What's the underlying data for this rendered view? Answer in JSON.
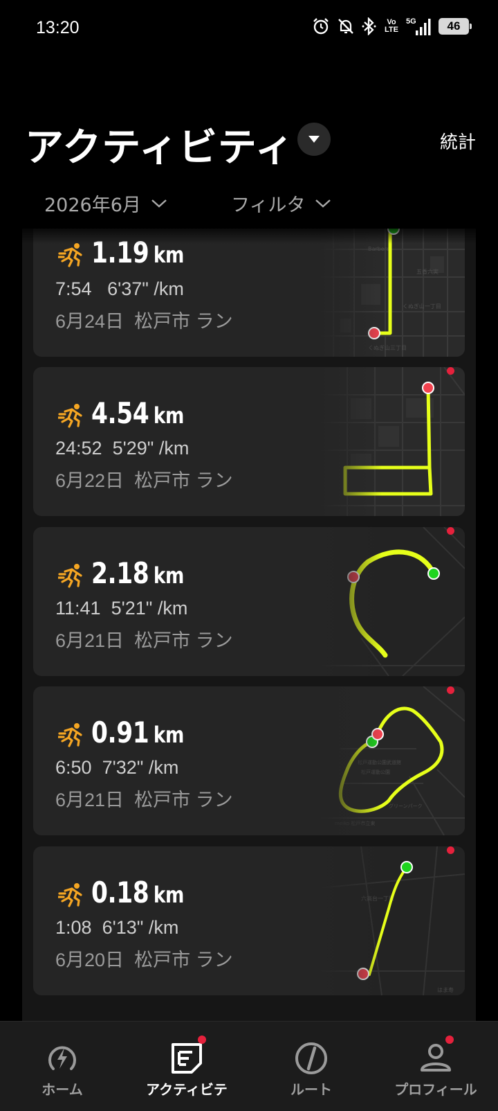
{
  "status_bar": {
    "time": "13:20",
    "volte_top": "Vo",
    "volte_bottom": "LTE",
    "network": "5G",
    "battery": "46",
    "icons": [
      "alarm-icon",
      "mute-icon",
      "bluetooth-icon",
      "volte-icon",
      "signal-icon",
      "battery-icon"
    ]
  },
  "header": {
    "title": "アクティビティ",
    "stats_label": "統計",
    "month_filter": "2026年6月",
    "filter_label": "フィルタ"
  },
  "activities": [
    {
      "distance": "1.19",
      "unit": "km",
      "duration": "7:54",
      "pace": "6'37\" /km",
      "date": "6月24日",
      "place": "松戸市",
      "type": "ラン",
      "unread": false
    },
    {
      "distance": "4.54",
      "unit": "km",
      "duration": "24:52",
      "pace": "5'29\" /km",
      "date": "6月22日",
      "place": "松戸市",
      "type": "ラン",
      "unread": true
    },
    {
      "distance": "2.18",
      "unit": "km",
      "duration": "11:41",
      "pace": "5'21\" /km",
      "date": "6月21日",
      "place": "松戸市",
      "type": "ラン",
      "unread": true
    },
    {
      "distance": "0.91",
      "unit": "km",
      "duration": "6:50",
      "pace": "7'32\" /km",
      "date": "6月21日",
      "place": "松戸市",
      "type": "ラン",
      "unread": true
    },
    {
      "distance": "0.18",
      "unit": "km",
      "duration": "1:08",
      "pace": "6'13\" /km",
      "date": "6月20日",
      "place": "松戸市",
      "type": "ラン",
      "unread": true
    }
  ],
  "nav": {
    "home": "ホーム",
    "activity": "アクティビテ",
    "route": "ルート",
    "profile": "プロフィール",
    "active": "activity"
  },
  "colors": {
    "route": "#e6ff1a",
    "start_marker": "#1fd41f",
    "end_marker": "#f2424f",
    "run_icon": "#f5a623",
    "badge": "#e5213c"
  }
}
